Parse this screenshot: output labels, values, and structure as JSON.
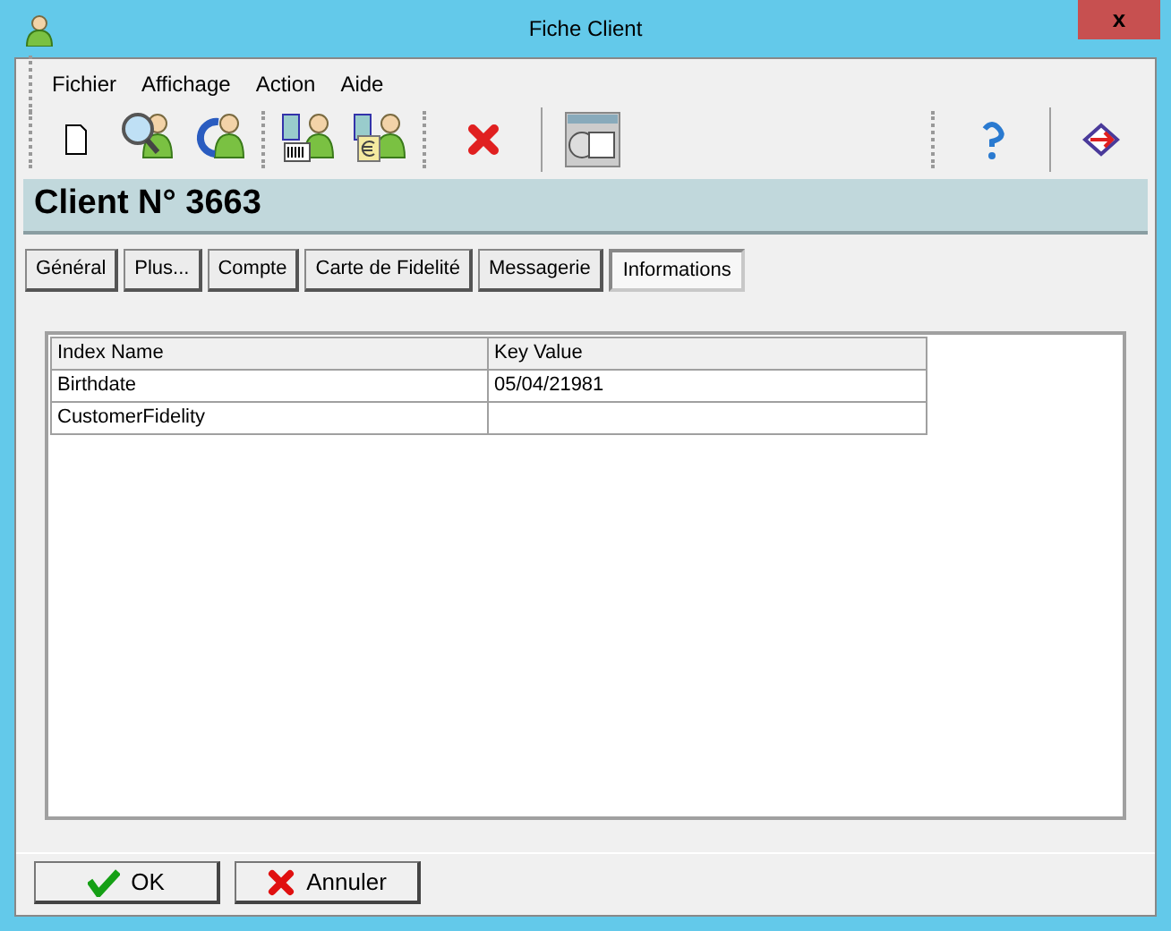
{
  "window": {
    "title": "Fiche Client",
    "close": "x"
  },
  "menu": [
    "Fichier",
    "Affichage",
    "Action",
    "Aide"
  ],
  "header": "Client N° 3663",
  "tabs": [
    {
      "label": "Général",
      "selected": false
    },
    {
      "label": "Plus...",
      "selected": false
    },
    {
      "label": "Compte",
      "selected": false
    },
    {
      "label": "Carte de Fidelité",
      "selected": false
    },
    {
      "label": "Messagerie",
      "selected": false
    },
    {
      "label": "Informations",
      "selected": true
    }
  ],
  "table": {
    "columns": [
      "Index Name",
      "Key Value"
    ],
    "rows": [
      [
        "Birthdate",
        "05/04/21981"
      ],
      [
        "CustomerFidelity",
        ""
      ]
    ]
  },
  "buttons": [
    {
      "label": "OK",
      "kind": "ok"
    },
    {
      "label": "Annuler",
      "kind": "cancel"
    }
  ]
}
